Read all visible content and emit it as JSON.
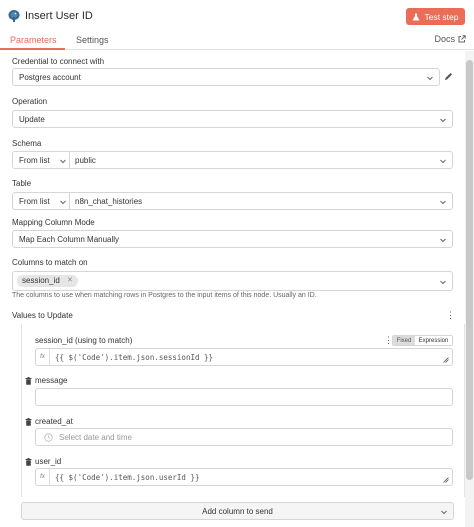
{
  "header": {
    "title": "Insert User ID",
    "test_label": "Test step",
    "accent": "#ea6d57"
  },
  "tabs": {
    "parameters": "Parameters",
    "settings": "Settings",
    "docs": "Docs"
  },
  "credential": {
    "label": "Credential to connect with",
    "value": "Postgres account"
  },
  "operation": {
    "label": "Operation",
    "value": "Update"
  },
  "schema": {
    "label": "Schema",
    "mode": "From list",
    "value": "public"
  },
  "table": {
    "label": "Table",
    "mode": "From list",
    "value": "n8n_chat_histories"
  },
  "mapping": {
    "label": "Mapping Column Mode",
    "value": "Map Each Column Manually"
  },
  "match": {
    "label": "Columns to match on",
    "chip": "session_id",
    "hint": "The columns to use when matching rows in Postgres to the input items of this node. Usually an ID."
  },
  "values": {
    "title": "Values to Update",
    "session_label": "session_id (using to match)",
    "toggle_fixed": "Fixed",
    "toggle_expression": "Expression",
    "session_expr": "{{ $('Code').item.json.sessionId }}",
    "message_label": "message",
    "created_label": "created_at",
    "created_placeholder": "Select date and time",
    "user_label": "user_id",
    "user_expr": "{{ $('Code').item.json.userId }}",
    "add_label": "Add column to send"
  }
}
